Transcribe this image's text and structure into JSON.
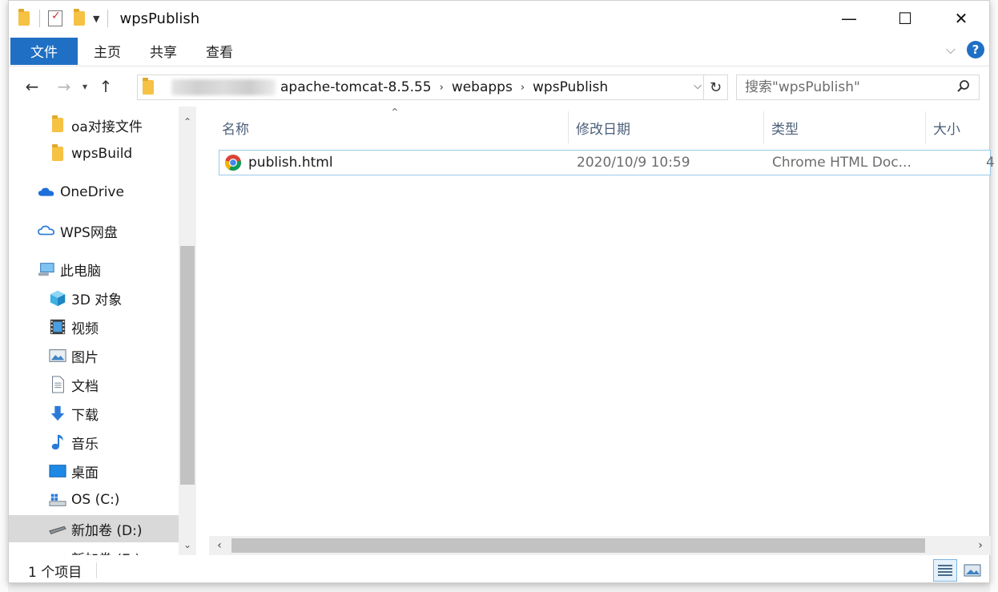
{
  "window": {
    "title": "wpsPublish",
    "controls": {
      "minimize": "—",
      "maximize": "☐",
      "close": "✕"
    }
  },
  "ribbon": {
    "file_tab": "文件",
    "tabs": [
      "主页",
      "共享",
      "查看"
    ]
  },
  "nav": {
    "back": "←",
    "forward": "→",
    "recent": "⌄",
    "up": "↑",
    "breadcrumb": [
      "apache-tomcat-8.5.55",
      "webapps",
      "wpsPublish"
    ],
    "breadcrumb_sep": "›",
    "refresh": "↻"
  },
  "search": {
    "placeholder": "搜索\"wpsPublish\""
  },
  "sidebar": {
    "items": [
      {
        "label": "oa对接文件",
        "icon": "folder-icon"
      },
      {
        "label": "wpsBuild",
        "icon": "folder-icon"
      },
      {
        "label": "OneDrive",
        "icon": "onedrive-cloud-icon"
      },
      {
        "label": "WPS网盘",
        "icon": "wps-cloud-icon"
      },
      {
        "label": "此电脑",
        "icon": "this-pc-icon"
      },
      {
        "label": "3D 对象",
        "icon": "3d-objects-icon"
      },
      {
        "label": "视频",
        "icon": "video-icon"
      },
      {
        "label": "图片",
        "icon": "pictures-icon"
      },
      {
        "label": "文档",
        "icon": "documents-icon"
      },
      {
        "label": "下载",
        "icon": "download-icon"
      },
      {
        "label": "音乐",
        "icon": "music-icon"
      },
      {
        "label": "桌面",
        "icon": "desktop-icon"
      },
      {
        "label": "OS (C:)",
        "icon": "drive-c-icon"
      },
      {
        "label": "新加卷 (D:)",
        "icon": "drive-icon"
      },
      {
        "label": "新加卷 (E:)",
        "icon": "drive-icon"
      }
    ]
  },
  "columns": {
    "name": "名称",
    "modified": "修改日期",
    "type": "类型",
    "size": "大小"
  },
  "files": [
    {
      "name": "publish.html",
      "modified": "2020/10/9 10:59",
      "type": "Chrome HTML Doc...",
      "size": "4"
    }
  ],
  "status": {
    "item_count": "1 个项目"
  },
  "colors": {
    "accent": "#1f6fc4",
    "selection_border": "#99c9e8"
  }
}
